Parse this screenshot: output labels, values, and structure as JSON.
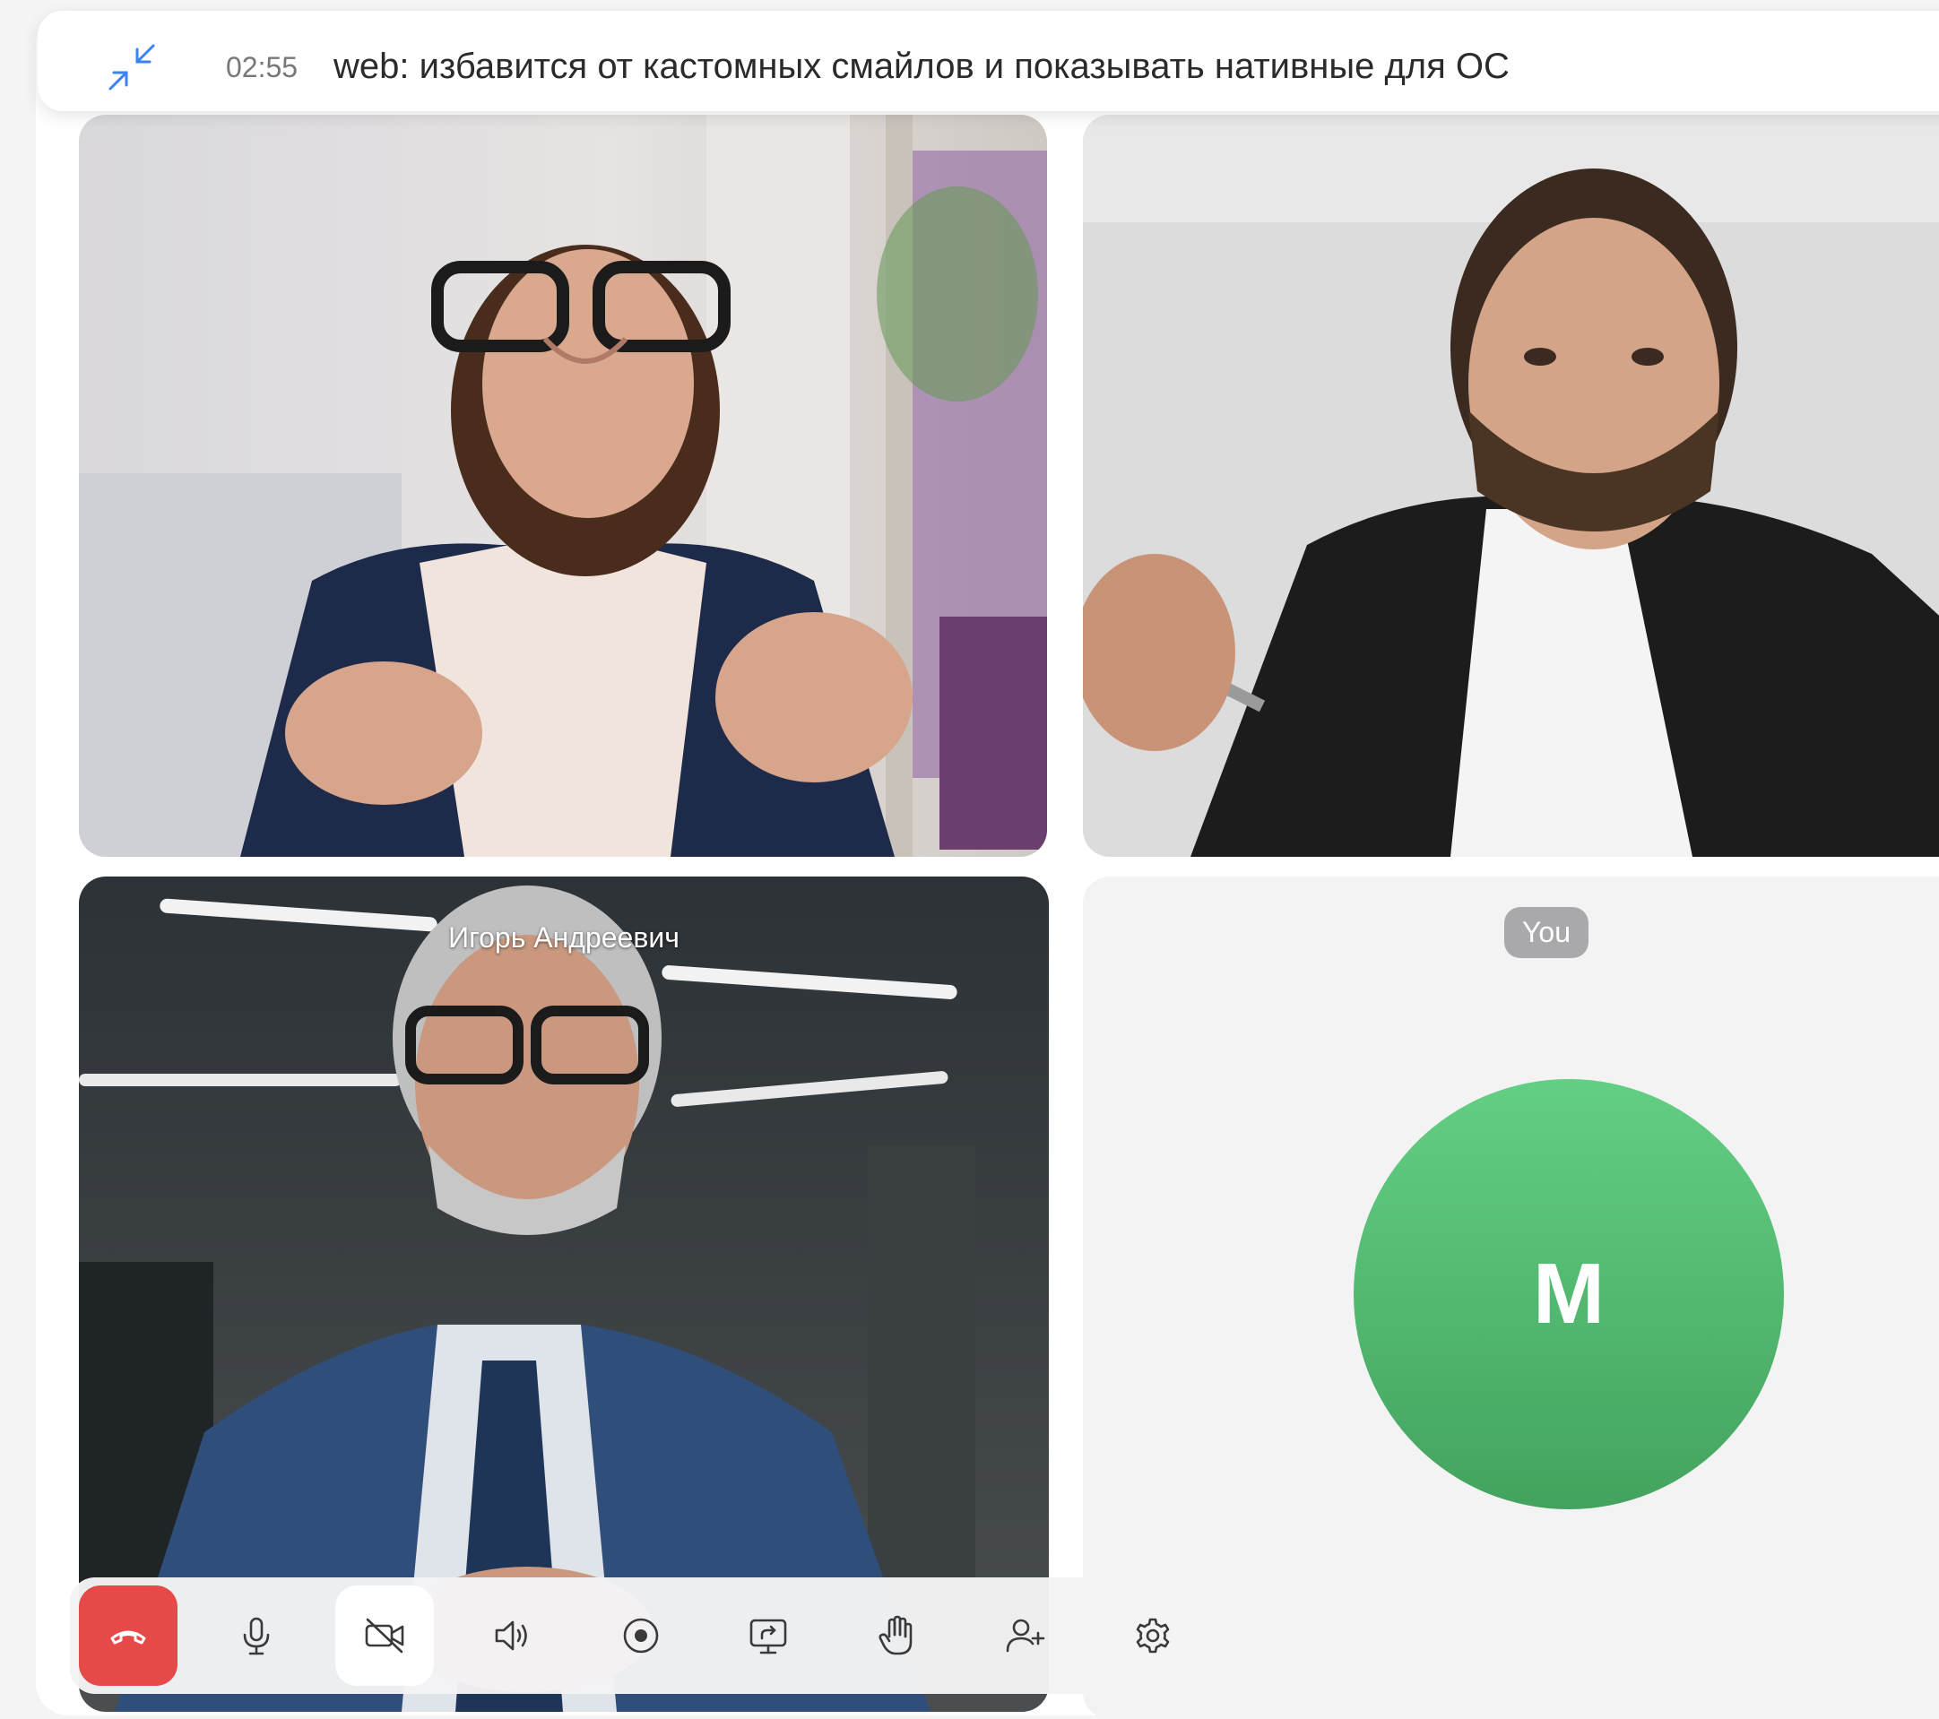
{
  "header": {
    "timer": "02:55",
    "title": "web: избавится от кастомных смайлов и показывать нативные для ОС"
  },
  "participants": [
    {
      "name": "",
      "video": "on"
    },
    {
      "name": "",
      "video": "on"
    },
    {
      "name": "Игорь Андреевич",
      "video": "on"
    },
    {
      "name": "You",
      "video": "off",
      "avatar_initial": "M",
      "avatar_color": "#4fb96d"
    }
  ],
  "toolbar": {
    "buttons": [
      {
        "icon": "hang-up-icon"
      },
      {
        "icon": "microphone-icon"
      },
      {
        "icon": "camera-off-icon",
        "active": true
      },
      {
        "icon": "speaker-icon"
      },
      {
        "icon": "record-icon"
      },
      {
        "icon": "screen-share-icon"
      },
      {
        "icon": "raise-hand-icon"
      },
      {
        "icon": "add-participant-icon"
      },
      {
        "icon": "settings-icon"
      }
    ]
  },
  "colors": {
    "accent": "#3b82f6",
    "end_call": "#e64a48",
    "avatar_green": "#4fb96d"
  }
}
